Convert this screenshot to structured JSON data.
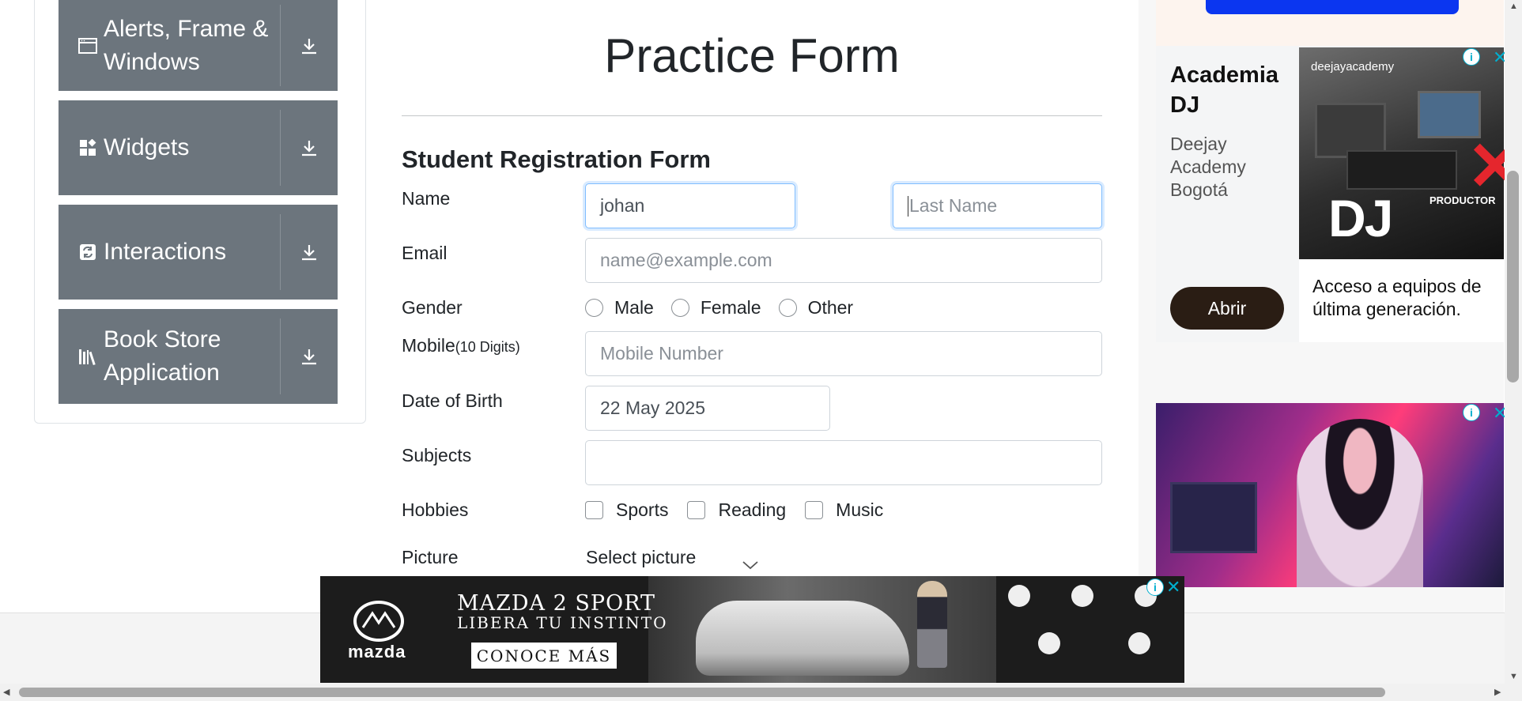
{
  "sidebar": {
    "groups": [
      {
        "label": "Alerts, Frame &\nWindows",
        "icon": "window-icon"
      },
      {
        "label": "Widgets",
        "icon": "widgets-icon"
      },
      {
        "label": "Interactions",
        "icon": "interactions-icon"
      },
      {
        "label": "Book Store Application",
        "icon": "books-icon"
      }
    ]
  },
  "form": {
    "page_title": "Practice Form",
    "subtitle": "Student Registration Form",
    "name_label": "Name",
    "first_name_value": "johan",
    "last_name_placeholder": "Last Name",
    "email_label": "Email",
    "email_placeholder": "name@example.com",
    "gender_label": "Gender",
    "gender_options": [
      "Male",
      "Female",
      "Other"
    ],
    "mobile_label": "Mobile",
    "mobile_hint": "(10 Digits)",
    "mobile_placeholder": "Mobile Number",
    "dob_label": "Date of Birth",
    "dob_value": "22 May 2025",
    "subjects_label": "Subjects",
    "subjects_value": "",
    "hobbies_label": "Hobbies",
    "hobby_options": [
      "Sports",
      "Reading",
      "Music"
    ],
    "picture_label": "Picture",
    "picture_button": "Select picture"
  },
  "ads": {
    "dj": {
      "title": "Academia DJ",
      "description": "Deejay Academy Bogotá",
      "cta": "Abrir",
      "blurb": "Acceso a equipos de última generación.",
      "logo_text": "deejayacademy",
      "big_text": "DJ",
      "badge_text": "PRODUCTOR"
    },
    "banner": {
      "brand": "mazda",
      "headline": "MAZDA 2 SPORT",
      "subheadline": "LIBERA TU INSTINTO",
      "cta": "CONOCE MÁS"
    },
    "info_symbol": "i",
    "close_symbol": "✕"
  },
  "colors": {
    "sidebar_bg": "#6c757d",
    "focus_border": "#80bdff",
    "ad_blue": "#0b36f0",
    "dj_button": "#2a1d14"
  }
}
